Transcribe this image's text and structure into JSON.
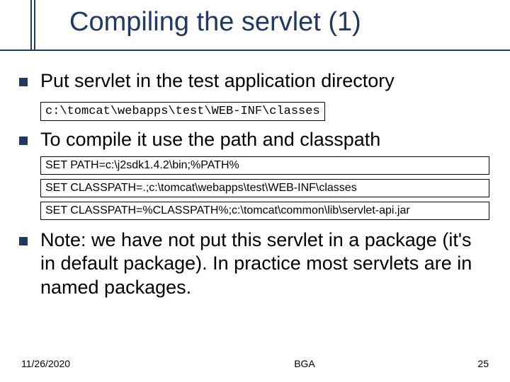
{
  "title": "Compiling the servlet (1)",
  "bullets": {
    "b1": "Put servlet in the test application directory",
    "b2": "To compile it use the path and classpath",
    "b3": "Note: we have not put this servlet in a package (it's in default package). In practice most servlets are in named packages."
  },
  "code": {
    "path_dir": "c:\\tomcat\\webapps\\test\\WEB-INF\\classes",
    "set_path": "SET PATH=c:\\j2sdk1.4.2\\bin;%PATH%",
    "set_cp1": "SET CLASSPATH=.;c:\\tomcat\\webapps\\test\\WEB-INF\\classes",
    "set_cp2": "SET CLASSPATH=%CLASSPATH%;c:\\tomcat\\common\\lib\\servlet-api.jar"
  },
  "footer": {
    "date": "11/26/2020",
    "center": "BGA",
    "page": "25"
  }
}
